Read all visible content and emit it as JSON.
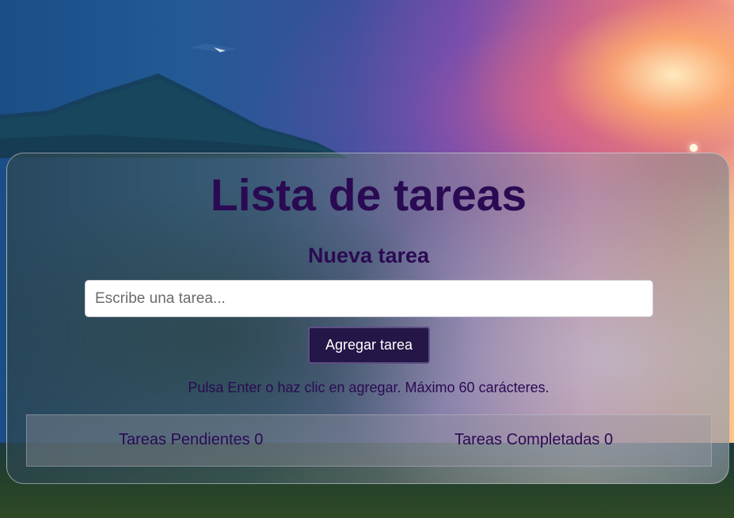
{
  "app": {
    "title": "Lista de tareas"
  },
  "form": {
    "heading": "Nueva tarea",
    "input_placeholder": "Escribe una tarea...",
    "input_value": "",
    "add_button_label": "Agregar tarea",
    "hint": "Pulsa Enter o haz clic en agregar. Máximo 60 carácteres."
  },
  "stats": {
    "pending_label": "Tareas Pendientes",
    "pending_count": "0",
    "completed_label": "Tareas Completadas",
    "completed_count": "0"
  },
  "colors": {
    "title_text": "#2a0a52",
    "button_bg": "#241646",
    "button_text": "#ffffff",
    "input_bg": "#ffffff"
  }
}
